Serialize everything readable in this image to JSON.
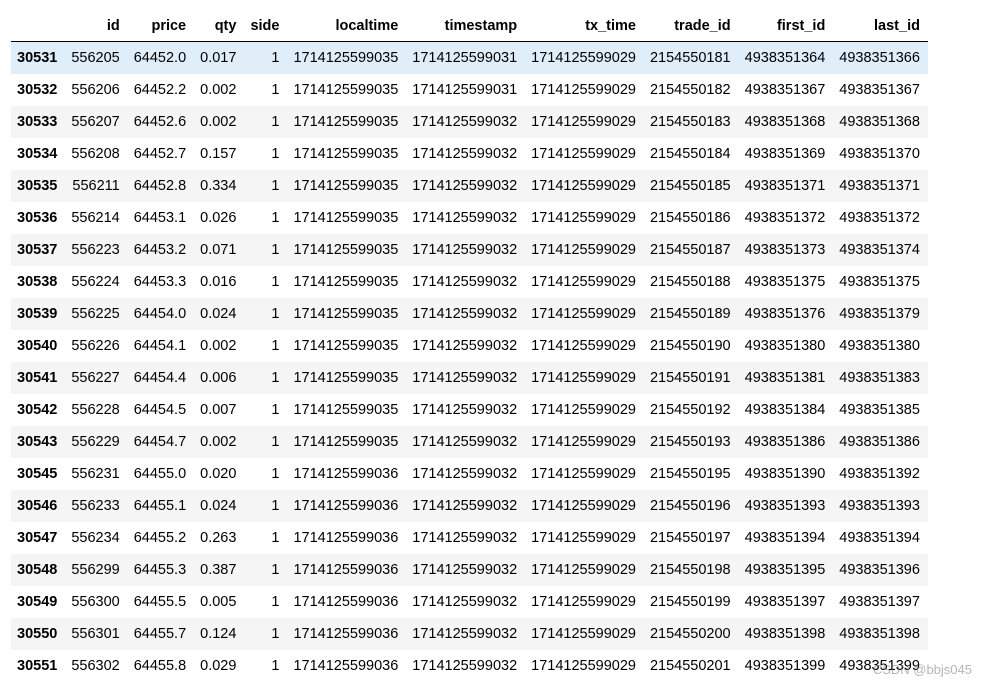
{
  "table": {
    "columns": [
      "",
      "id",
      "price",
      "qty",
      "side",
      "localtime",
      "timestamp",
      "tx_time",
      "trade_id",
      "first_id",
      "last_id"
    ],
    "rows": [
      [
        "30531",
        "556205",
        "64452.0",
        "0.017",
        "1",
        "1714125599035",
        "1714125599031",
        "1714125599029",
        "2154550181",
        "4938351364",
        "4938351366"
      ],
      [
        "30532",
        "556206",
        "64452.2",
        "0.002",
        "1",
        "1714125599035",
        "1714125599031",
        "1714125599029",
        "2154550182",
        "4938351367",
        "4938351367"
      ],
      [
        "30533",
        "556207",
        "64452.6",
        "0.002",
        "1",
        "1714125599035",
        "1714125599032",
        "1714125599029",
        "2154550183",
        "4938351368",
        "4938351368"
      ],
      [
        "30534",
        "556208",
        "64452.7",
        "0.157",
        "1",
        "1714125599035",
        "1714125599032",
        "1714125599029",
        "2154550184",
        "4938351369",
        "4938351370"
      ],
      [
        "30535",
        "556211",
        "64452.8",
        "0.334",
        "1",
        "1714125599035",
        "1714125599032",
        "1714125599029",
        "2154550185",
        "4938351371",
        "4938351371"
      ],
      [
        "30536",
        "556214",
        "64453.1",
        "0.026",
        "1",
        "1714125599035",
        "1714125599032",
        "1714125599029",
        "2154550186",
        "4938351372",
        "4938351372"
      ],
      [
        "30537",
        "556223",
        "64453.2",
        "0.071",
        "1",
        "1714125599035",
        "1714125599032",
        "1714125599029",
        "2154550187",
        "4938351373",
        "4938351374"
      ],
      [
        "30538",
        "556224",
        "64453.3",
        "0.016",
        "1",
        "1714125599035",
        "1714125599032",
        "1714125599029",
        "2154550188",
        "4938351375",
        "4938351375"
      ],
      [
        "30539",
        "556225",
        "64454.0",
        "0.024",
        "1",
        "1714125599035",
        "1714125599032",
        "1714125599029",
        "2154550189",
        "4938351376",
        "4938351379"
      ],
      [
        "30540",
        "556226",
        "64454.1",
        "0.002",
        "1",
        "1714125599035",
        "1714125599032",
        "1714125599029",
        "2154550190",
        "4938351380",
        "4938351380"
      ],
      [
        "30541",
        "556227",
        "64454.4",
        "0.006",
        "1",
        "1714125599035",
        "1714125599032",
        "1714125599029",
        "2154550191",
        "4938351381",
        "4938351383"
      ],
      [
        "30542",
        "556228",
        "64454.5",
        "0.007",
        "1",
        "1714125599035",
        "1714125599032",
        "1714125599029",
        "2154550192",
        "4938351384",
        "4938351385"
      ],
      [
        "30543",
        "556229",
        "64454.7",
        "0.002",
        "1",
        "1714125599035",
        "1714125599032",
        "1714125599029",
        "2154550193",
        "4938351386",
        "4938351386"
      ],
      [
        "30545",
        "556231",
        "64455.0",
        "0.020",
        "1",
        "1714125599036",
        "1714125599032",
        "1714125599029",
        "2154550195",
        "4938351390",
        "4938351392"
      ],
      [
        "30546",
        "556233",
        "64455.1",
        "0.024",
        "1",
        "1714125599036",
        "1714125599032",
        "1714125599029",
        "2154550196",
        "4938351393",
        "4938351393"
      ],
      [
        "30547",
        "556234",
        "64455.2",
        "0.263",
        "1",
        "1714125599036",
        "1714125599032",
        "1714125599029",
        "2154550197",
        "4938351394",
        "4938351394"
      ],
      [
        "30548",
        "556299",
        "64455.3",
        "0.387",
        "1",
        "1714125599036",
        "1714125599032",
        "1714125599029",
        "2154550198",
        "4938351395",
        "4938351396"
      ],
      [
        "30549",
        "556300",
        "64455.5",
        "0.005",
        "1",
        "1714125599036",
        "1714125599032",
        "1714125599029",
        "2154550199",
        "4938351397",
        "4938351397"
      ],
      [
        "30550",
        "556301",
        "64455.7",
        "0.124",
        "1",
        "1714125599036",
        "1714125599032",
        "1714125599029",
        "2154550200",
        "4938351398",
        "4938351398"
      ],
      [
        "30551",
        "556302",
        "64455.8",
        "0.029",
        "1",
        "1714125599036",
        "1714125599032",
        "1714125599029",
        "2154550201",
        "4938351399",
        "4938351399"
      ]
    ],
    "hovered_row_index": 0
  },
  "watermark": "CSDN @bbjs045"
}
